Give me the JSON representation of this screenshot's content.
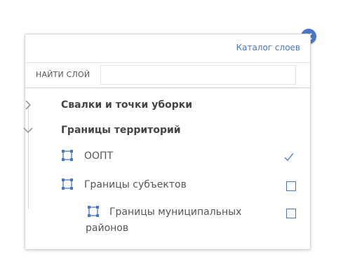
{
  "header": {
    "catalog_link": "Каталог слоев"
  },
  "search": {
    "label": "НАЙТИ СЛОЙ",
    "value": "",
    "placeholder": ""
  },
  "groups": [
    {
      "title": "Свалки и точки уборки",
      "expanded": false
    },
    {
      "title": "Границы территорий",
      "expanded": true,
      "layers": [
        {
          "label": "ООПТ",
          "checked": true
        },
        {
          "label": "Границы субъектов",
          "checked": false
        },
        {
          "label": "Границы муниципальных районов",
          "checked": false
        }
      ]
    }
  ],
  "colors": {
    "accent": "#4a76c8",
    "text": "#444444",
    "border": "#d6d6d6"
  },
  "icons": {
    "close": "close-icon",
    "collapsed": "chevron-right-icon",
    "expanded": "chevron-down-icon",
    "layer": "polygon-layer-icon"
  }
}
